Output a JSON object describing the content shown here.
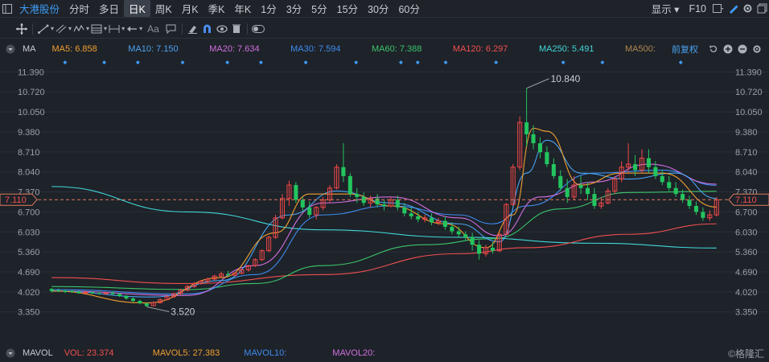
{
  "topbar": {
    "stock_name": "大港股份",
    "periods": [
      {
        "label": "分时",
        "active": false
      },
      {
        "label": "多日",
        "active": false
      },
      {
        "label": "日K",
        "active": true
      },
      {
        "label": "周K",
        "active": false
      },
      {
        "label": "月K",
        "active": false
      },
      {
        "label": "季K",
        "active": false
      },
      {
        "label": "年K",
        "active": false
      },
      {
        "label": "1分",
        "active": false
      },
      {
        "label": "3分",
        "active": false
      },
      {
        "label": "5分",
        "active": false
      },
      {
        "label": "15分",
        "active": false
      },
      {
        "label": "30分",
        "active": false
      },
      {
        "label": "60分",
        "active": false
      }
    ],
    "display_label": "显示",
    "f10_label": "F10"
  },
  "toolbar": {
    "text_tool_label": "Aa"
  },
  "ma_bar": {
    "label": "MA",
    "items": [
      {
        "text": "MA5: 6.858",
        "color": "#f0a030"
      },
      {
        "text": "MA10: 7.150",
        "color": "#4aa3f0"
      },
      {
        "text": "MA20: 7.634",
        "color": "#d070e0"
      },
      {
        "text": "MA30: 7.594",
        "color": "#3d8cf0"
      },
      {
        "text": "MA60: 7.388",
        "color": "#3bc46a"
      },
      {
        "text": "MA120: 6.297",
        "color": "#f05050"
      },
      {
        "text": "MA250: 5.491",
        "color": "#40d8d8"
      },
      {
        "text": "MA500:",
        "color": "#b08850"
      }
    ],
    "adjust_label": "前复权"
  },
  "vol_bar": {
    "label": "MAVOL",
    "items": [
      {
        "text": "VOL: 23.374",
        "color": "#f05050"
      },
      {
        "text": "MAVOL5: 27.383",
        "color": "#f0a030"
      },
      {
        "text": "MAVOL10:",
        "color": "#3d8cf0"
      },
      {
        "text": "MAVOL20:",
        "color": "#d070e0"
      }
    ]
  },
  "watermark": "©格隆汇",
  "colors": {
    "up": "#f04848",
    "down": "#22c55e",
    "background": "#1e2229",
    "grid": "#2b3038"
  },
  "chart_data": {
    "type": "candlestick",
    "y_ticks": [
      "11.390",
      "10.720",
      "10.050",
      "9.380",
      "8.710",
      "8.040",
      "7.370",
      "6.700",
      "6.030",
      "5.360",
      "4.690",
      "4.020",
      "3.350"
    ],
    "ylim": [
      2.75,
      11.75
    ],
    "current_price_label": "7.110",
    "annotations": [
      {
        "text": "10.840",
        "value": 10.84
      },
      {
        "text": "3.520",
        "value": 3.52
      }
    ],
    "candles": [
      [
        4.12,
        4.15,
        4.05,
        4.0
      ],
      [
        4.08,
        4.13,
        4.05,
        4.02
      ],
      [
        4.06,
        4.1,
        4.02,
        3.98
      ],
      [
        4.05,
        4.09,
        4.03,
        3.99
      ],
      [
        4.03,
        4.07,
        3.98,
        3.95
      ],
      [
        4.0,
        4.06,
        4.01,
        3.96
      ],
      [
        4.01,
        4.05,
        3.97,
        3.94
      ],
      [
        3.98,
        4.03,
        3.96,
        3.92
      ],
      [
        3.96,
        4.01,
        3.99,
        3.93
      ],
      [
        3.99,
        4.04,
        3.95,
        3.91
      ],
      [
        3.95,
        3.98,
        3.88,
        3.85
      ],
      [
        3.88,
        3.92,
        3.8,
        3.76
      ],
      [
        3.8,
        3.84,
        3.72,
        3.68
      ],
      [
        3.72,
        3.76,
        3.64,
        3.6
      ],
      [
        3.63,
        3.66,
        3.55,
        3.52
      ],
      [
        3.56,
        3.7,
        3.66,
        3.54
      ],
      [
        3.66,
        3.8,
        3.76,
        3.63
      ],
      [
        3.76,
        3.9,
        3.86,
        3.73
      ],
      [
        3.86,
        4.0,
        3.96,
        3.82
      ],
      [
        3.96,
        4.12,
        4.08,
        3.92
      ],
      [
        4.08,
        4.25,
        4.2,
        4.04
      ],
      [
        4.2,
        4.35,
        4.3,
        4.16
      ],
      [
        4.3,
        4.42,
        4.38,
        4.26
      ],
      [
        4.38,
        4.5,
        4.45,
        4.33
      ],
      [
        4.45,
        4.6,
        4.55,
        4.4
      ],
      [
        4.55,
        4.7,
        4.62,
        4.5
      ],
      [
        4.62,
        4.72,
        4.58,
        4.54
      ],
      [
        4.58,
        4.68,
        4.65,
        4.54
      ],
      [
        4.65,
        4.8,
        4.76,
        4.6
      ],
      [
        4.76,
        4.92,
        4.9,
        4.7
      ],
      [
        4.9,
        5.15,
        5.1,
        4.85
      ],
      [
        5.1,
        5.45,
        5.4,
        5.05
      ],
      [
        5.4,
        5.9,
        5.85,
        5.35
      ],
      [
        5.85,
        6.6,
        6.5,
        5.8
      ],
      [
        6.5,
        7.3,
        7.15,
        6.45
      ],
      [
        7.15,
        7.75,
        7.6,
        6.9
      ],
      [
        7.6,
        7.7,
        7.1,
        7.0
      ],
      [
        7.1,
        7.2,
        6.85,
        6.7
      ],
      [
        6.85,
        7.05,
        6.6,
        6.5
      ],
      [
        6.6,
        6.9,
        6.85,
        6.45
      ],
      [
        6.85,
        7.2,
        7.1,
        6.75
      ],
      [
        7.1,
        7.6,
        7.5,
        7.0
      ],
      [
        7.5,
        8.3,
        8.2,
        7.45
      ],
      [
        8.2,
        9.0,
        7.9,
        7.7
      ],
      [
        7.9,
        8.0,
        7.3,
        7.2
      ],
      [
        7.3,
        7.5,
        7.2,
        7.0
      ],
      [
        7.2,
        7.35,
        7.0,
        6.9
      ],
      [
        7.0,
        7.25,
        7.15,
        6.85
      ],
      [
        7.15,
        7.3,
        6.95,
        6.85
      ],
      [
        6.95,
        7.1,
        6.9,
        6.75
      ],
      [
        6.9,
        7.2,
        7.1,
        6.85
      ],
      [
        7.1,
        7.25,
        6.85,
        6.75
      ],
      [
        6.85,
        7.0,
        6.65,
        6.55
      ],
      [
        6.65,
        6.85,
        6.55,
        6.45
      ],
      [
        6.55,
        6.7,
        6.45,
        6.35
      ],
      [
        6.45,
        6.6,
        6.5,
        6.35
      ],
      [
        6.5,
        6.65,
        6.35,
        6.25
      ],
      [
        6.35,
        6.5,
        6.4,
        6.25
      ],
      [
        6.4,
        6.55,
        6.2,
        6.1
      ],
      [
        6.2,
        6.35,
        6.05,
        5.95
      ],
      [
        6.05,
        6.2,
        5.95,
        5.85
      ],
      [
        5.95,
        6.05,
        5.85,
        5.75
      ],
      [
        5.85,
        6.0,
        5.6,
        5.4
      ],
      [
        5.6,
        5.75,
        5.3,
        5.1
      ],
      [
        5.3,
        5.6,
        5.5,
        5.2
      ],
      [
        5.5,
        5.7,
        5.4,
        5.3
      ],
      [
        5.4,
        6.0,
        5.95,
        5.35
      ],
      [
        5.95,
        7.0,
        6.95,
        5.9
      ],
      [
        6.95,
        8.3,
        8.2,
        6.9
      ],
      [
        8.2,
        9.9,
        9.7,
        8.1
      ],
      [
        9.7,
        10.84,
        9.3,
        8.9
      ],
      [
        9.3,
        9.6,
        9.0,
        8.8
      ],
      [
        9.0,
        9.2,
        8.7,
        8.5
      ],
      [
        8.7,
        8.9,
        8.3,
        8.2
      ],
      [
        8.3,
        8.5,
        7.9,
        7.8
      ],
      [
        7.9,
        8.1,
        7.5,
        7.4
      ],
      [
        7.5,
        7.8,
        7.2,
        7.0
      ],
      [
        7.2,
        7.9,
        7.6,
        7.1
      ],
      [
        7.6,
        7.9,
        7.5,
        7.3
      ],
      [
        7.5,
        7.7,
        7.3,
        7.1
      ],
      [
        7.3,
        7.5,
        6.9,
        6.8
      ],
      [
        6.9,
        7.2,
        7.0,
        6.8
      ],
      [
        7.0,
        7.5,
        7.4,
        6.95
      ],
      [
        7.4,
        7.9,
        7.8,
        7.3
      ],
      [
        7.8,
        8.4,
        8.2,
        7.7
      ],
      [
        8.2,
        9.0,
        8.3,
        8.0
      ],
      [
        8.3,
        8.6,
        8.1,
        7.9
      ],
      [
        8.1,
        8.8,
        8.5,
        8.0
      ],
      [
        8.5,
        8.8,
        8.2,
        8.0
      ],
      [
        8.2,
        8.4,
        7.9,
        7.8
      ],
      [
        7.9,
        8.1,
        7.7,
        7.6
      ],
      [
        7.7,
        7.9,
        7.5,
        7.4
      ],
      [
        7.5,
        7.7,
        7.3,
        7.2
      ],
      [
        7.3,
        7.45,
        7.1,
        7.0
      ],
      [
        7.1,
        7.25,
        6.9,
        6.8
      ],
      [
        6.9,
        7.05,
        6.7,
        6.6
      ],
      [
        6.7,
        6.85,
        6.5,
        6.4
      ],
      [
        6.5,
        6.75,
        6.6,
        6.4
      ],
      [
        6.6,
        7.2,
        7.11,
        6.55
      ]
    ],
    "moving_averages": [
      {
        "name": "MA250",
        "color": "#40d8d8",
        "points": [
          [
            0,
            7.55
          ],
          [
            20,
            6.7
          ],
          [
            40,
            6.1
          ],
          [
            60,
            5.85
          ],
          [
            80,
            5.65
          ],
          [
            98,
            5.49
          ]
        ]
      },
      {
        "name": "MA120",
        "color": "#f05050",
        "points": [
          [
            0,
            4.5
          ],
          [
            20,
            4.3
          ],
          [
            40,
            4.6
          ],
          [
            60,
            5.3
          ],
          [
            70,
            5.5
          ],
          [
            85,
            5.95
          ],
          [
            98,
            6.3
          ]
        ]
      },
      {
        "name": "MA60",
        "color": "#3bc46a",
        "points": [
          [
            0,
            4.2
          ],
          [
            20,
            4.1
          ],
          [
            30,
            4.3
          ],
          [
            40,
            4.9
          ],
          [
            55,
            5.6
          ],
          [
            65,
            5.8
          ],
          [
            75,
            6.8
          ],
          [
            85,
            7.35
          ],
          [
            98,
            7.39
          ]
        ]
      },
      {
        "name": "MA30",
        "color": "#3d8cf0",
        "points": [
          [
            0,
            4.1
          ],
          [
            20,
            3.95
          ],
          [
            30,
            4.6
          ],
          [
            40,
            6.6
          ],
          [
            50,
            6.9
          ],
          [
            60,
            6.6
          ],
          [
            65,
            6.3
          ],
          [
            70,
            6.9
          ],
          [
            80,
            8.0
          ],
          [
            90,
            8.1
          ],
          [
            98,
            7.59
          ]
        ]
      },
      {
        "name": "MA20",
        "color": "#d070e0",
        "points": [
          [
            0,
            4.05
          ],
          [
            20,
            3.9
          ],
          [
            30,
            4.9
          ],
          [
            40,
            7.0
          ],
          [
            50,
            7.2
          ],
          [
            60,
            6.5
          ],
          [
            66,
            5.9
          ],
          [
            72,
            7.2
          ],
          [
            80,
            7.7
          ],
          [
            88,
            8.3
          ],
          [
            98,
            7.63
          ]
        ]
      },
      {
        "name": "MA10",
        "color": "#4aa3f0",
        "points": [
          [
            0,
            4.05
          ],
          [
            15,
            3.85
          ],
          [
            25,
            4.4
          ],
          [
            35,
            6.6
          ],
          [
            42,
            7.4
          ],
          [
            50,
            7.0
          ],
          [
            60,
            6.3
          ],
          [
            66,
            5.7
          ],
          [
            70,
            8.0
          ],
          [
            73,
            9.1
          ],
          [
            78,
            8.0
          ],
          [
            85,
            7.8
          ],
          [
            92,
            8.0
          ],
          [
            98,
            7.15
          ]
        ]
      },
      {
        "name": "MA5",
        "color": "#f0a030",
        "points": [
          [
            0,
            4.05
          ],
          [
            14,
            3.65
          ],
          [
            25,
            4.5
          ],
          [
            33,
            6.0
          ],
          [
            38,
            7.3
          ],
          [
            44,
            7.3
          ],
          [
            50,
            6.9
          ],
          [
            58,
            6.3
          ],
          [
            64,
            5.5
          ],
          [
            68,
            6.6
          ],
          [
            71,
            9.5
          ],
          [
            73,
            9.4
          ],
          [
            78,
            7.6
          ],
          [
            84,
            8.0
          ],
          [
            90,
            8.0
          ],
          [
            98,
            6.86
          ]
        ]
      }
    ],
    "signal_marker_indices": [
      3,
      10,
      16,
      24,
      32,
      38,
      46,
      55,
      63,
      66,
      71,
      80,
      92,
      99,
      113
    ]
  }
}
